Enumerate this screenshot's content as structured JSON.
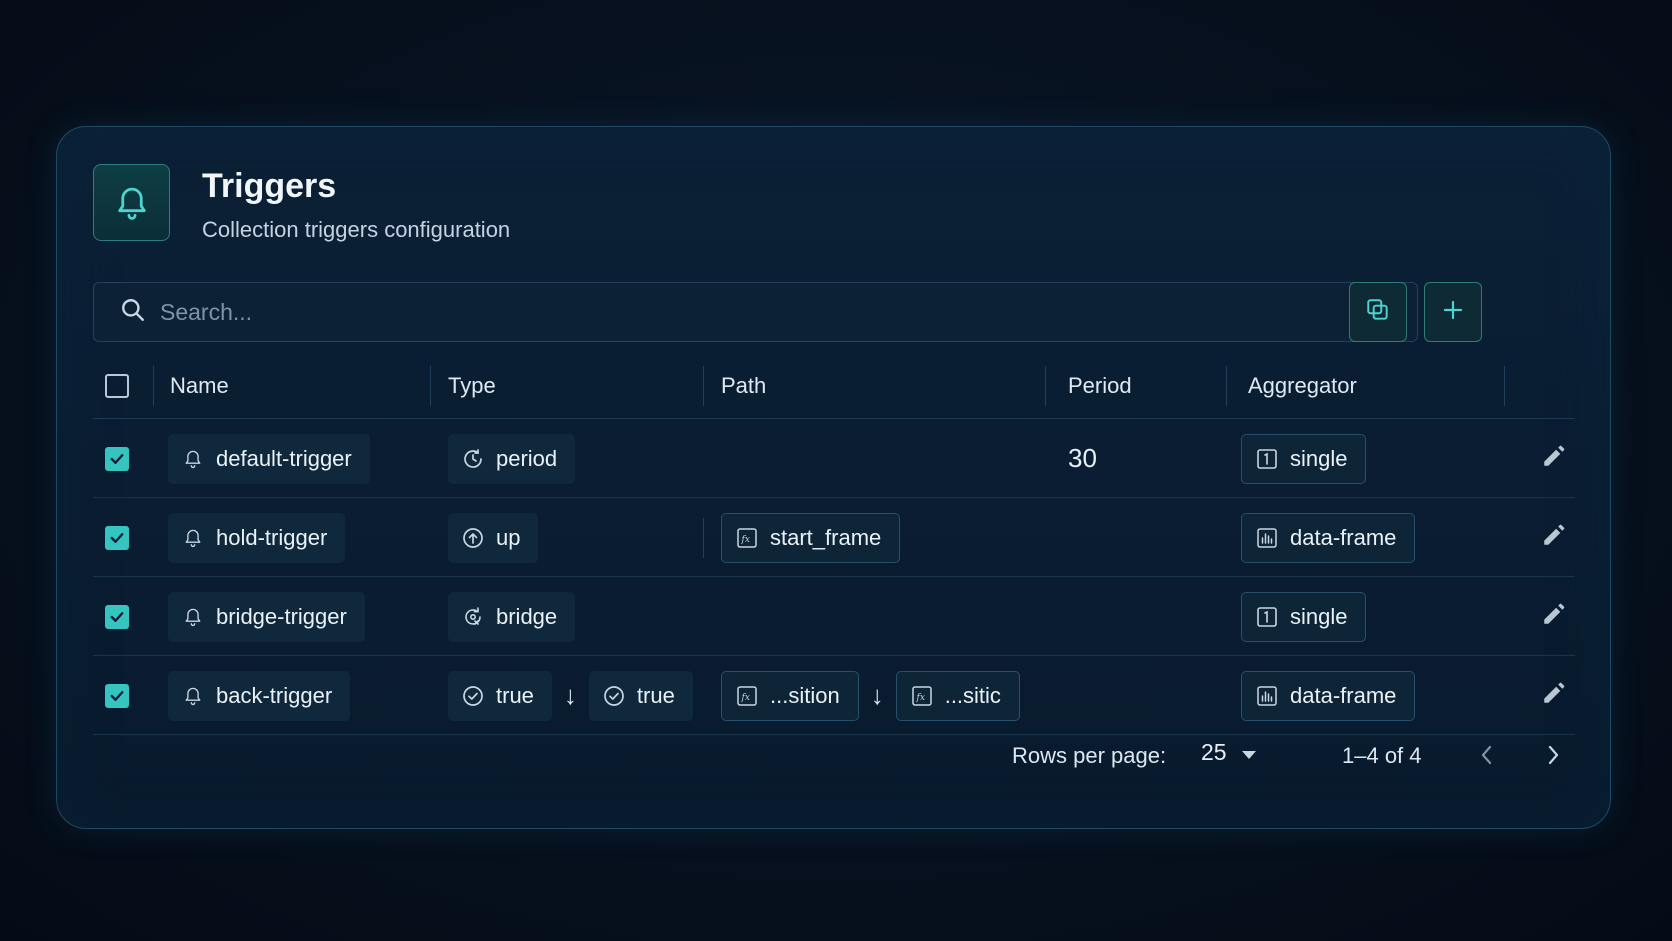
{
  "header": {
    "title": "Triggers",
    "subtitle": "Collection triggers configuration",
    "icon": "bell-icon"
  },
  "search": {
    "placeholder": "Search..."
  },
  "toolbar": {
    "copy_icon": "copy-icon",
    "add_icon": "plus-icon"
  },
  "columns": [
    "Name",
    "Type",
    "Path",
    "Period",
    "Aggregator"
  ],
  "rows": [
    {
      "checked": true,
      "name": "default-trigger",
      "type": [
        {
          "label": "period",
          "icon": "period-icon"
        }
      ],
      "path": [],
      "period": "30",
      "aggregator": {
        "label": "single",
        "icon": "single-icon"
      }
    },
    {
      "checked": true,
      "name": "hold-trigger",
      "type": [
        {
          "label": "up",
          "icon": "arrow-up-circle-icon"
        }
      ],
      "path": [
        "start_frame"
      ],
      "period": "",
      "aggregator": {
        "label": "data-frame",
        "icon": "data-frame-icon"
      }
    },
    {
      "checked": true,
      "name": "bridge-trigger",
      "type": [
        {
          "label": "bridge",
          "icon": "bridge-icon"
        }
      ],
      "path": [],
      "period": "",
      "aggregator": {
        "label": "single",
        "icon": "single-icon"
      }
    },
    {
      "checked": true,
      "name": "back-trigger",
      "type": [
        {
          "label": "true",
          "icon": "check-circle-icon"
        },
        {
          "label": "true",
          "icon": "check-circle-icon"
        }
      ],
      "path": [
        "...sition",
        "...sitic"
      ],
      "period": "",
      "aggregator": {
        "label": "data-frame",
        "icon": "data-frame-icon"
      }
    }
  ],
  "pagination": {
    "rows_per_page_label": "Rows per page:",
    "rows_per_page_value": "25",
    "range": "1–4 of 4"
  },
  "colors": {
    "accent": "#35c4c0",
    "panel_bg": "#0b2036",
    "border": "#1f4a63"
  }
}
